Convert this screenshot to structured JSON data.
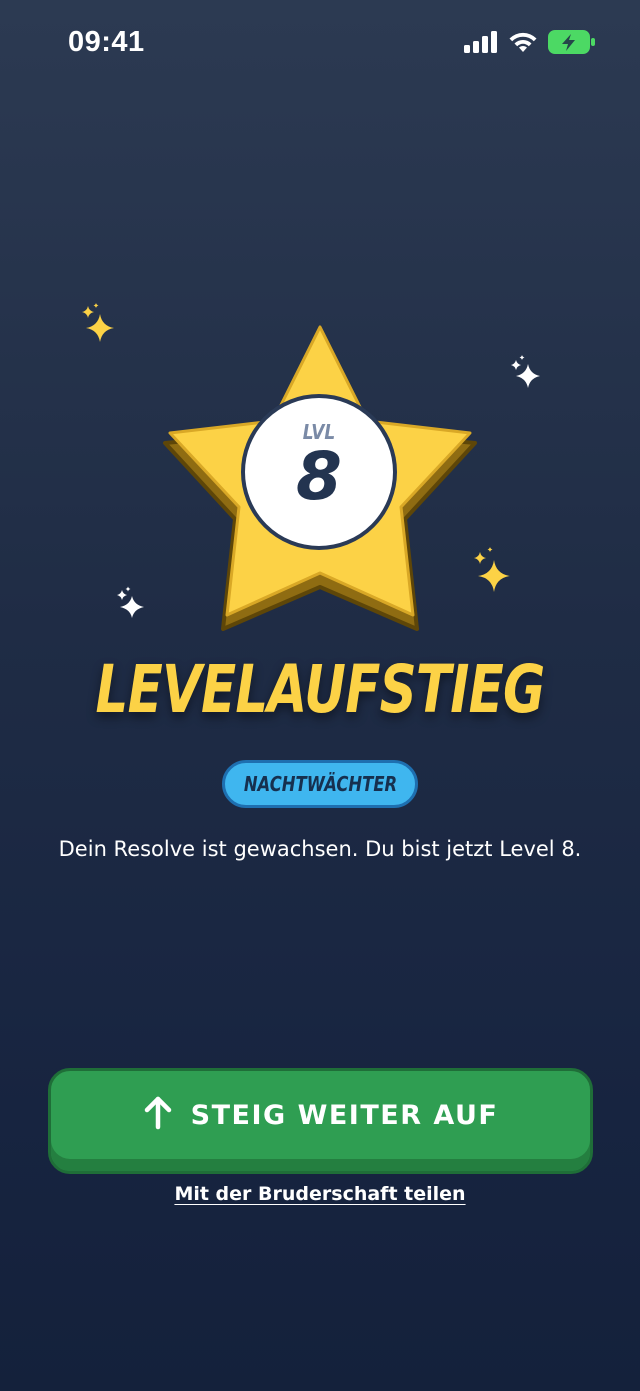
{
  "status_bar": {
    "time": "09:41",
    "icons": [
      "cellular-signal-icon",
      "wifi-icon",
      "battery-charging-icon"
    ]
  },
  "level_card": {
    "lvl_label": "LVL",
    "level_number": "8",
    "headline": "LEVELAUFSTIEG",
    "rank": "NACHTWÄCHTER",
    "message": "Dein Resolve ist gewachsen. Du bist jetzt Level 8."
  },
  "actions": {
    "primary_label": "STEIG WEITER AUF",
    "primary_icon": "arrow-up-icon",
    "share_label": "Mit der Bruderschaft teilen"
  },
  "colors": {
    "star": "#fcd246",
    "star_dark": "#8f6c12",
    "headline": "#fcd246",
    "rank_pill": "#3fb6ef",
    "button": "#2f9e52",
    "battery": "#4cd964"
  }
}
